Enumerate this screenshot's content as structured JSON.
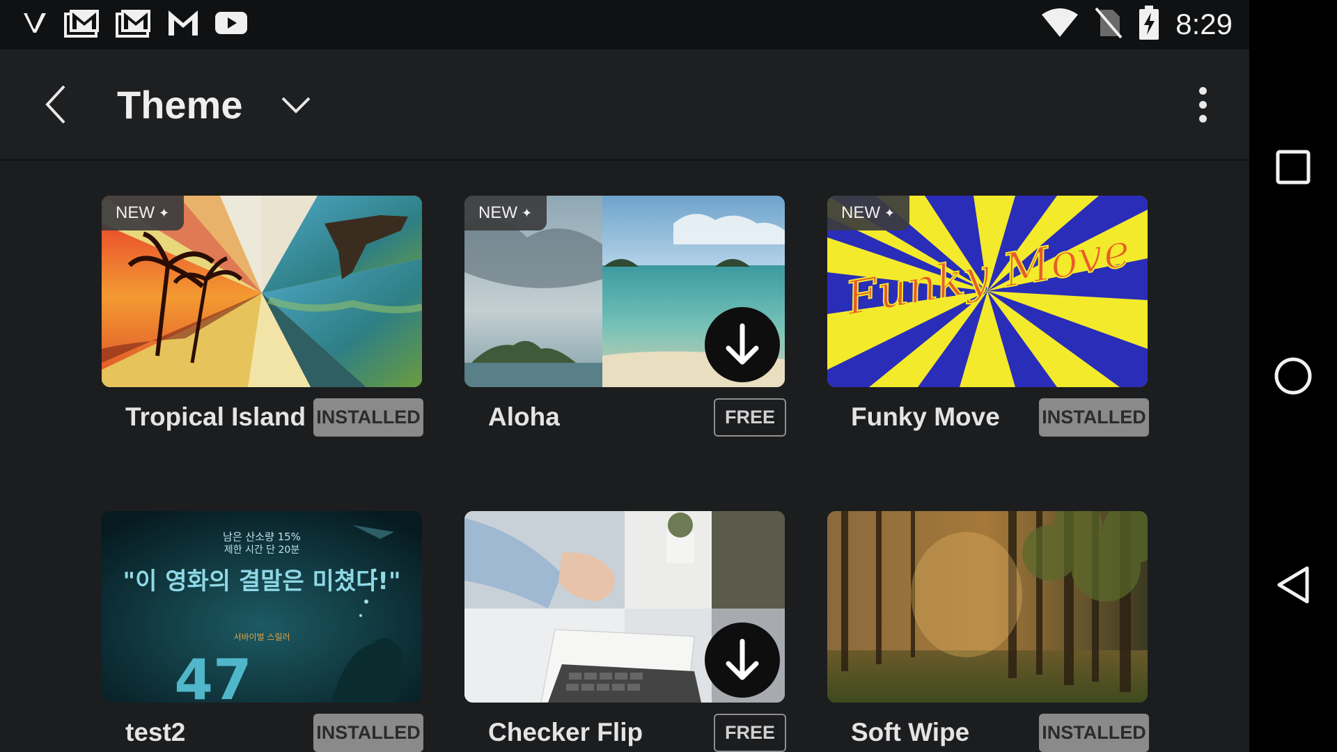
{
  "status_bar": {
    "time": "8:29",
    "left_icons": [
      "v-app-icon",
      "gmail-icon",
      "gmail-icon",
      "gmail-icon",
      "youtube-icon"
    ],
    "right_icons": [
      "wifi-icon",
      "no-sim-icon",
      "battery-charging-icon"
    ]
  },
  "app_bar": {
    "title": "Theme",
    "back_icon": "chevron-left-icon",
    "dropdown_icon": "chevron-down-icon",
    "menu_icon": "more-vert-icon"
  },
  "new_badge_label": "NEW",
  "themes": [
    {
      "name": "Tropical Island",
      "status": "INSTALLED",
      "is_new": true,
      "downloadable": false
    },
    {
      "name": "Aloha",
      "status": "FREE",
      "is_new": true,
      "downloadable": true
    },
    {
      "name": "Funky Move",
      "status": "INSTALLED",
      "is_new": true,
      "downloadable": false
    },
    {
      "name": "test2",
      "status": "INSTALLED",
      "is_new": false,
      "downloadable": false
    },
    {
      "name": "Checker Flip",
      "status": "FREE",
      "is_new": false,
      "downloadable": true
    },
    {
      "name": "Soft Wipe",
      "status": "INSTALLED",
      "is_new": false,
      "downloadable": false
    }
  ],
  "thumbnail_art": {
    "funky_move_logo": "Funky Move",
    "test2_poster_line1": "남은 산소량 15%",
    "test2_poster_line2": "제한 시간 단 20분",
    "test2_poster_headline": "\"이 영화의 결말은 미쳤다!\"",
    "test2_poster_genre": "서바이벌 스릴러",
    "test2_poster_number": "47"
  },
  "nav_bar": {
    "items": [
      "recents-icon",
      "home-icon",
      "back-triangle-icon"
    ]
  },
  "colors": {
    "background": "#1c1d1f",
    "status_bar": "#101112",
    "installed_badge": "#8a8a8a",
    "free_outline": "#8f8f8f"
  }
}
